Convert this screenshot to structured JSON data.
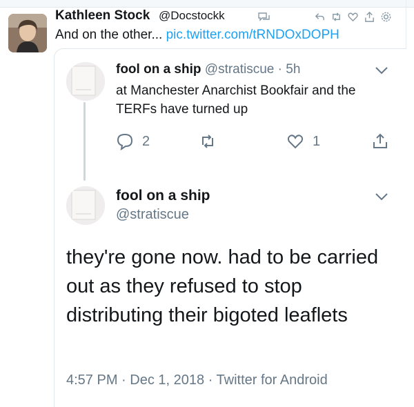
{
  "outer_tweet": {
    "author_name": "Kathleen Stock",
    "author_handle": "@Docstockk",
    "text_prefix": "And on the other...",
    "link_text": "pic.twitter.com/tRNDOxDOPH"
  },
  "quoted_reply": {
    "author_name": "fool on a ship",
    "author_handle": "@stratiscue",
    "separator": "·",
    "age": "5h",
    "text": "at Manchester Anarchist Bookfair and the TERFs have turned up",
    "actions": {
      "reply_count": "2",
      "retweet_count": "",
      "like_count": "1"
    }
  },
  "main_tweet": {
    "author_name": "fool on a ship",
    "author_handle": "@stratiscue",
    "text": "they're gone now. had to be carried out as they refused to stop distributing their bigoted leaflets",
    "meta": "4:57 PM · Dec 1, 2018 · Twitter for Android"
  },
  "colors": {
    "link": "#1da1f2",
    "secondary_text": "#657786",
    "primary_text": "#14171a",
    "border": "#e1e8ed"
  }
}
